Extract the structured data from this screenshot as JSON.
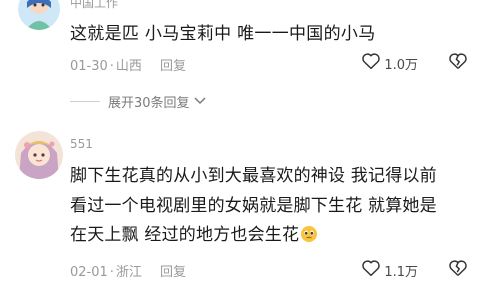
{
  "comments": [
    {
      "username": "中国工作",
      "text": "这就是匹 小马宝莉中 唯一一中国的小马",
      "date": "01-30",
      "location": "山西",
      "reply_label": "回复",
      "likes": "1.0万"
    },
    {
      "username": "551",
      "lines": [
        "脚下生花真的从小到大最喜欢的神设 我记得以前",
        "看过一个电视剧里的女娲就是脚下生花 就算她是",
        "在天上飘 经过的地方也会生花"
      ],
      "emoji": "pleading-face",
      "date": "02-01",
      "location": "浙江",
      "reply_label": "回复",
      "likes": "1.1万"
    }
  ],
  "expand_replies": "展开30条回复",
  "icons": {
    "like": "heart-outline-icon",
    "dislike": "heart-broken-icon",
    "expand": "chevron-down-icon"
  }
}
